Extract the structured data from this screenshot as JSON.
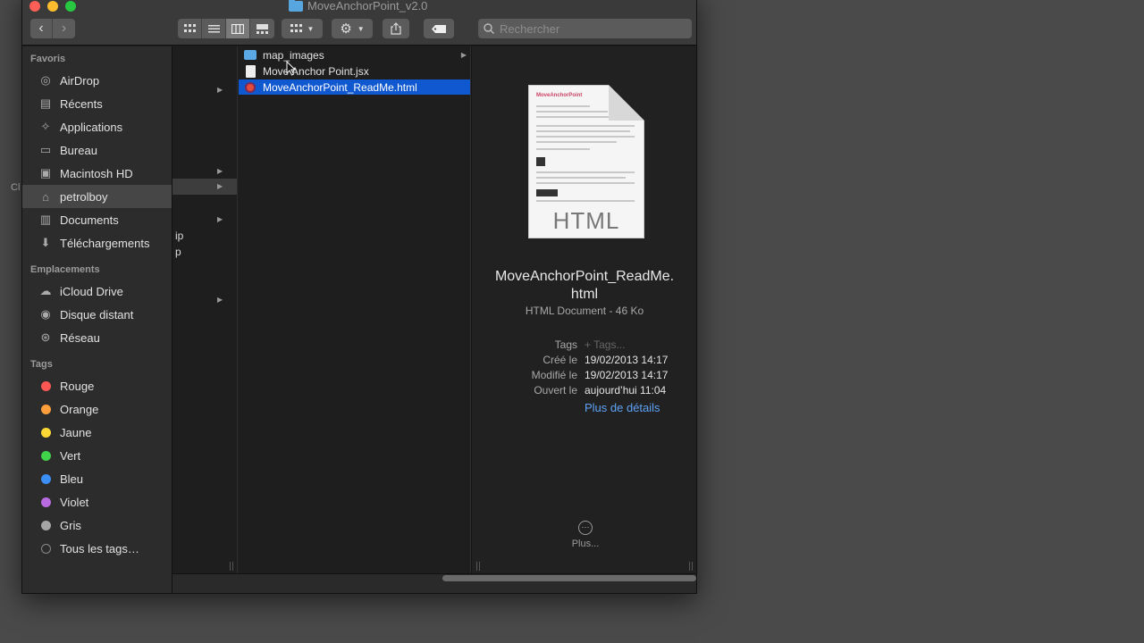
{
  "window": {
    "title": "MoveAnchorPoint_v2.0"
  },
  "desktop": {
    "edge_text": "Cl"
  },
  "toolbar": {
    "back_label": "‹",
    "forward_label": "›",
    "search_placeholder": "Rechercher"
  },
  "sidebar": {
    "favorites_header": "Favoris",
    "favorites": [
      {
        "label": "AirDrop",
        "icon": "airdrop-icon"
      },
      {
        "label": "Récents",
        "icon": "recents-icon"
      },
      {
        "label": "Applications",
        "icon": "applications-icon"
      },
      {
        "label": "Bureau",
        "icon": "desktop-icon"
      },
      {
        "label": "Macintosh HD",
        "icon": "harddrive-icon"
      },
      {
        "label": "petrolboy",
        "icon": "home-icon"
      },
      {
        "label": "Documents",
        "icon": "documents-icon"
      },
      {
        "label": "Téléchargements",
        "icon": "downloads-icon"
      }
    ],
    "locations_header": "Emplacements",
    "locations": [
      {
        "label": "iCloud Drive",
        "icon": "cloud-icon"
      },
      {
        "label": "Disque distant",
        "icon": "disc-icon"
      },
      {
        "label": "Réseau",
        "icon": "network-icon"
      }
    ],
    "tags_header": "Tags",
    "tags": [
      {
        "label": "Rouge",
        "color": "#fc5753"
      },
      {
        "label": "Orange",
        "color": "#fd9e3d"
      },
      {
        "label": "Jaune",
        "color": "#fdd835"
      },
      {
        "label": "Vert",
        "color": "#3fd44a"
      },
      {
        "label": "Bleu",
        "color": "#3a8ef6"
      },
      {
        "label": "Violet",
        "color": "#b96ae0"
      },
      {
        "label": "Gris",
        "color": "#a5a5a5"
      },
      {
        "label": "Tous les tags…",
        "color": "none"
      }
    ]
  },
  "column1": {
    "partial_text_1": "ip",
    "partial_text_2": "p"
  },
  "files": [
    {
      "name": "map_images",
      "kind": "folder",
      "has_children": true
    },
    {
      "name": "Move Anchor Point.jsx",
      "kind": "jsx",
      "has_children": false
    },
    {
      "name": "MoveAnchorPoint_ReadMe.html",
      "kind": "html",
      "has_children": false,
      "selected": true
    }
  ],
  "preview": {
    "thumb_label": "HTML",
    "thumb_brand": "MoveAnchorPoint",
    "name_line1": "MoveAnchorPoint_ReadMe.",
    "name_line2": "html",
    "kind_size": "HTML Document - 46 Ko",
    "tags_label": "Tags",
    "tags_placeholder": "+ Tags...",
    "created_label": "Créé le",
    "created_value": "19/02/2013 14:17",
    "modified_label": "Modifié le",
    "modified_value": "19/02/2013 14:17",
    "opened_label": "Ouvert le",
    "opened_value": "aujourd’hui 11:04",
    "more_details": "Plus de détails",
    "more_label": "Plus...",
    "more_glyph": "···"
  },
  "colors": {
    "selection": "#0f58d0",
    "link": "#5ea2f5"
  }
}
